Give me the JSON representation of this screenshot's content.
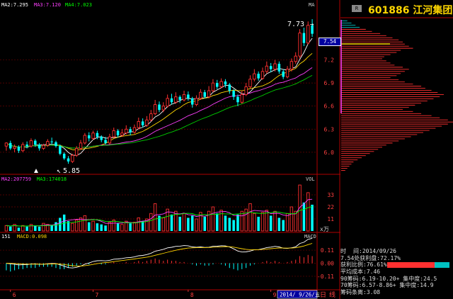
{
  "chart_data": {
    "type": "candlestick",
    "price_panel": {
      "indicators": [
        {
          "label": "MA2:7.295",
          "color": "#ffffff"
        },
        {
          "label": "MA3:7.120",
          "color": "#ff40ff"
        },
        {
          "label": "MA4:7.023",
          "color": "#00ff00"
        }
      ],
      "right_tag": "MA",
      "high_marker": "7.73",
      "low_marker": "5.85",
      "current_price_tag": "7.54",
      "yaxis_ticks": [
        "7.2",
        "6.9",
        "6.6",
        "6.3",
        "6.0"
      ],
      "ylim": [
        5.75,
        7.85
      ],
      "candles": [
        [
          6.08,
          6.12,
          6.02,
          6.13
        ],
        [
          6.12,
          6.05,
          6.03,
          6.15
        ],
        [
          6.05,
          6.07,
          6.0,
          6.1
        ],
        [
          6.07,
          6.02,
          5.99,
          6.09
        ],
        [
          6.02,
          6.1,
          6.0,
          6.13
        ],
        [
          6.1,
          6.08,
          6.05,
          6.14
        ],
        [
          6.08,
          6.15,
          6.06,
          6.18
        ],
        [
          6.15,
          6.1,
          6.07,
          6.17
        ],
        [
          6.1,
          6.05,
          6.02,
          6.12
        ],
        [
          6.05,
          6.09,
          6.03,
          6.11
        ],
        [
          6.09,
          6.14,
          6.07,
          6.17
        ],
        [
          6.14,
          6.13,
          6.1,
          6.19
        ],
        [
          6.13,
          6.08,
          6.06,
          6.15
        ],
        [
          6.08,
          5.98,
          5.96,
          6.1
        ],
        [
          5.98,
          5.92,
          5.9,
          6.0
        ],
        [
          5.92,
          5.88,
          5.85,
          5.95
        ],
        [
          5.88,
          5.96,
          5.86,
          5.98
        ],
        [
          5.96,
          6.05,
          5.94,
          6.08
        ],
        [
          6.05,
          6.12,
          6.03,
          6.16
        ],
        [
          6.12,
          6.22,
          6.1,
          6.25
        ],
        [
          6.22,
          6.18,
          6.14,
          6.26
        ],
        [
          6.18,
          6.25,
          6.16,
          6.28
        ],
        [
          6.25,
          6.2,
          6.17,
          6.28
        ],
        [
          6.2,
          6.16,
          6.13,
          6.22
        ],
        [
          6.16,
          6.12,
          6.1,
          6.2
        ],
        [
          6.12,
          6.2,
          6.1,
          6.24
        ],
        [
          6.2,
          6.28,
          6.18,
          6.32
        ],
        [
          6.28,
          6.22,
          6.19,
          6.3
        ],
        [
          6.22,
          6.25,
          6.2,
          6.3
        ],
        [
          6.25,
          6.3,
          6.23,
          6.35
        ],
        [
          6.3,
          6.26,
          6.22,
          6.33
        ],
        [
          6.26,
          6.32,
          6.24,
          6.36
        ],
        [
          6.32,
          6.4,
          6.3,
          6.45
        ],
        [
          6.4,
          6.35,
          6.32,
          6.44
        ],
        [
          6.35,
          6.42,
          6.33,
          6.47
        ],
        [
          6.42,
          6.5,
          6.4,
          6.55
        ],
        [
          6.5,
          6.62,
          6.48,
          6.68
        ],
        [
          6.62,
          6.55,
          6.52,
          6.66
        ],
        [
          6.55,
          6.6,
          6.52,
          6.65
        ],
        [
          6.6,
          6.7,
          6.58,
          6.75
        ],
        [
          6.7,
          6.65,
          6.62,
          6.76
        ],
        [
          6.65,
          6.72,
          6.63,
          6.78
        ],
        [
          6.72,
          6.68,
          6.64,
          6.74
        ],
        [
          6.68,
          6.75,
          6.66,
          6.8
        ],
        [
          6.75,
          6.7,
          6.67,
          6.79
        ],
        [
          6.7,
          6.62,
          6.58,
          6.72
        ],
        [
          6.62,
          6.7,
          6.6,
          6.74
        ],
        [
          6.7,
          6.78,
          6.68,
          6.82
        ],
        [
          6.78,
          6.72,
          6.7,
          6.81
        ],
        [
          6.72,
          6.8,
          6.7,
          6.86
        ],
        [
          6.8,
          6.9,
          6.78,
          6.95
        ],
        [
          6.9,
          6.85,
          6.82,
          6.94
        ],
        [
          6.85,
          6.92,
          6.83,
          6.96
        ],
        [
          6.92,
          6.88,
          6.84,
          6.95
        ],
        [
          6.88,
          6.8,
          6.76,
          6.9
        ],
        [
          6.8,
          6.72,
          6.68,
          6.82
        ],
        [
          6.72,
          6.65,
          6.6,
          6.75
        ],
        [
          6.65,
          6.75,
          6.63,
          6.8
        ],
        [
          6.75,
          6.85,
          6.73,
          6.9
        ],
        [
          6.85,
          6.95,
          6.83,
          7.0
        ],
        [
          6.95,
          7.02,
          6.92,
          7.08
        ],
        [
          7.02,
          6.96,
          6.93,
          7.05
        ],
        [
          6.96,
          7.05,
          6.94,
          7.1
        ],
        [
          7.05,
          7.12,
          7.02,
          7.18
        ],
        [
          7.12,
          7.08,
          7.04,
          7.16
        ],
        [
          7.08,
          7.15,
          7.05,
          7.2
        ],
        [
          7.15,
          7.05,
          7.02,
          7.18
        ],
        [
          7.05,
          6.98,
          6.95,
          7.08
        ],
        [
          6.98,
          7.08,
          6.96,
          7.12
        ],
        [
          7.08,
          7.18,
          7.05,
          7.22
        ],
        [
          7.18,
          7.25,
          7.15,
          7.3
        ],
        [
          7.25,
          7.55,
          7.22,
          7.6
        ],
        [
          7.55,
          7.42,
          7.38,
          7.62
        ],
        [
          7.42,
          7.65,
          7.4,
          7.7
        ],
        [
          7.65,
          7.54,
          7.5,
          7.73
        ]
      ]
    },
    "volume_panel": {
      "indicators": [
        {
          "label": "MA2:207759",
          "color": "#ff40ff"
        },
        {
          "label": "MA3:174018",
          "color": "#00ff00"
        }
      ],
      "right_tag": "VOL",
      "yaxis_ticks": [
        "33",
        "22",
        "11"
      ],
      "unit": "x万",
      "ylim": [
        0,
        44
      ],
      "values": [
        5,
        4,
        6,
        3,
        5,
        4,
        6,
        5,
        4,
        7,
        6,
        5,
        8,
        12,
        15,
        9,
        7,
        10,
        12,
        14,
        8,
        9,
        7,
        6,
        5,
        8,
        10,
        7,
        6,
        9,
        7,
        8,
        12,
        9,
        11,
        16,
        25,
        14,
        12,
        20,
        15,
        18,
        13,
        16,
        12,
        14,
        11,
        17,
        13,
        18,
        22,
        16,
        19,
        14,
        12,
        10,
        15,
        18,
        20,
        25,
        16,
        13,
        17,
        19,
        14,
        18,
        12,
        10,
        16,
        22,
        18,
        42,
        26,
        35,
        24
      ]
    },
    "macd_panel": {
      "indicators": [
        {
          "label": "151",
          "color": "#ffffff"
        },
        {
          "label": "MACD:0.098",
          "color": "#ffd700"
        }
      ],
      "right_tag": "MACD",
      "yaxis_ticks": [
        "0.11",
        "0.00",
        "-0.11"
      ],
      "ylim": [
        -0.2,
        0.2
      ],
      "hist": [
        -0.06,
        -0.07,
        -0.06,
        -0.05,
        -0.05,
        -0.04,
        -0.04,
        -0.04,
        -0.03,
        -0.03,
        -0.03,
        -0.03,
        -0.04,
        -0.05,
        -0.05,
        -0.04,
        -0.03,
        -0.02,
        -0.01,
        0.0,
        -0.01,
        0.0,
        0.0,
        -0.01,
        -0.01,
        0.0,
        0.01,
        0.0,
        0.0,
        0.01,
        0.0,
        0.01,
        0.02,
        0.01,
        0.02,
        0.03,
        0.04,
        0.03,
        0.02,
        0.03,
        0.02,
        0.02,
        0.01,
        0.01,
        0.0,
        -0.01,
        -0.02,
        -0.01,
        -0.02,
        -0.02,
        -0.01,
        0.0,
        -0.01,
        -0.02,
        -0.04,
        -0.05,
        -0.06,
        -0.05,
        -0.04,
        -0.02,
        -0.01,
        0.0,
        0.01,
        0.02,
        0.01,
        0.02,
        0.01,
        0.0,
        0.01,
        0.02,
        0.03,
        0.06,
        0.05,
        0.07,
        0.06
      ]
    },
    "x_ticks": [
      {
        "label": "6",
        "i": 1
      },
      {
        "label": "7",
        "i": 21
      },
      {
        "label": "8",
        "i": 44
      },
      {
        "label": "9",
        "i": 64
      }
    ],
    "date_box": "2014/ 9/26/五",
    "bottom_tabs": [
      "日",
      "线"
    ]
  },
  "sidebar": {
    "badge": "R",
    "code": "601886",
    "name": "江河集团",
    "profile_ticks": [
      "7.2",
      "6.9",
      "6.6",
      "6.3",
      "6.0"
    ],
    "profile_bars": [
      6,
      10,
      14,
      18,
      24,
      30,
      38,
      44,
      50,
      56,
      60,
      62,
      66,
      70,
      58,
      54,
      48,
      42,
      40,
      44,
      48,
      52,
      60,
      66,
      62,
      58,
      54,
      48,
      56,
      62,
      70,
      78,
      82,
      88,
      94,
      100,
      96,
      90,
      84,
      78,
      72,
      66,
      60,
      70,
      78,
      88,
      96,
      104,
      110,
      104,
      98,
      92,
      86,
      80,
      74,
      68,
      62,
      56,
      50,
      44,
      40,
      36,
      32,
      28,
      24,
      20,
      16,
      12,
      10,
      8,
      6,
      4
    ],
    "stats": {
      "time_label": "时",
      "time_value": "间:2014/09/26",
      "profit_label": "7.54处获利盘:72.17%",
      "ratio_label": "获利比例:76.61%",
      "avg_cost": "平均成本:7.46",
      "c90": "90筹码:6.19-10.20+ 集中度:24.5",
      "c70": "70筹码:6.57-8.86+ 集中度:14.9",
      "chip_ratio": "筹码条离:3.08"
    }
  }
}
